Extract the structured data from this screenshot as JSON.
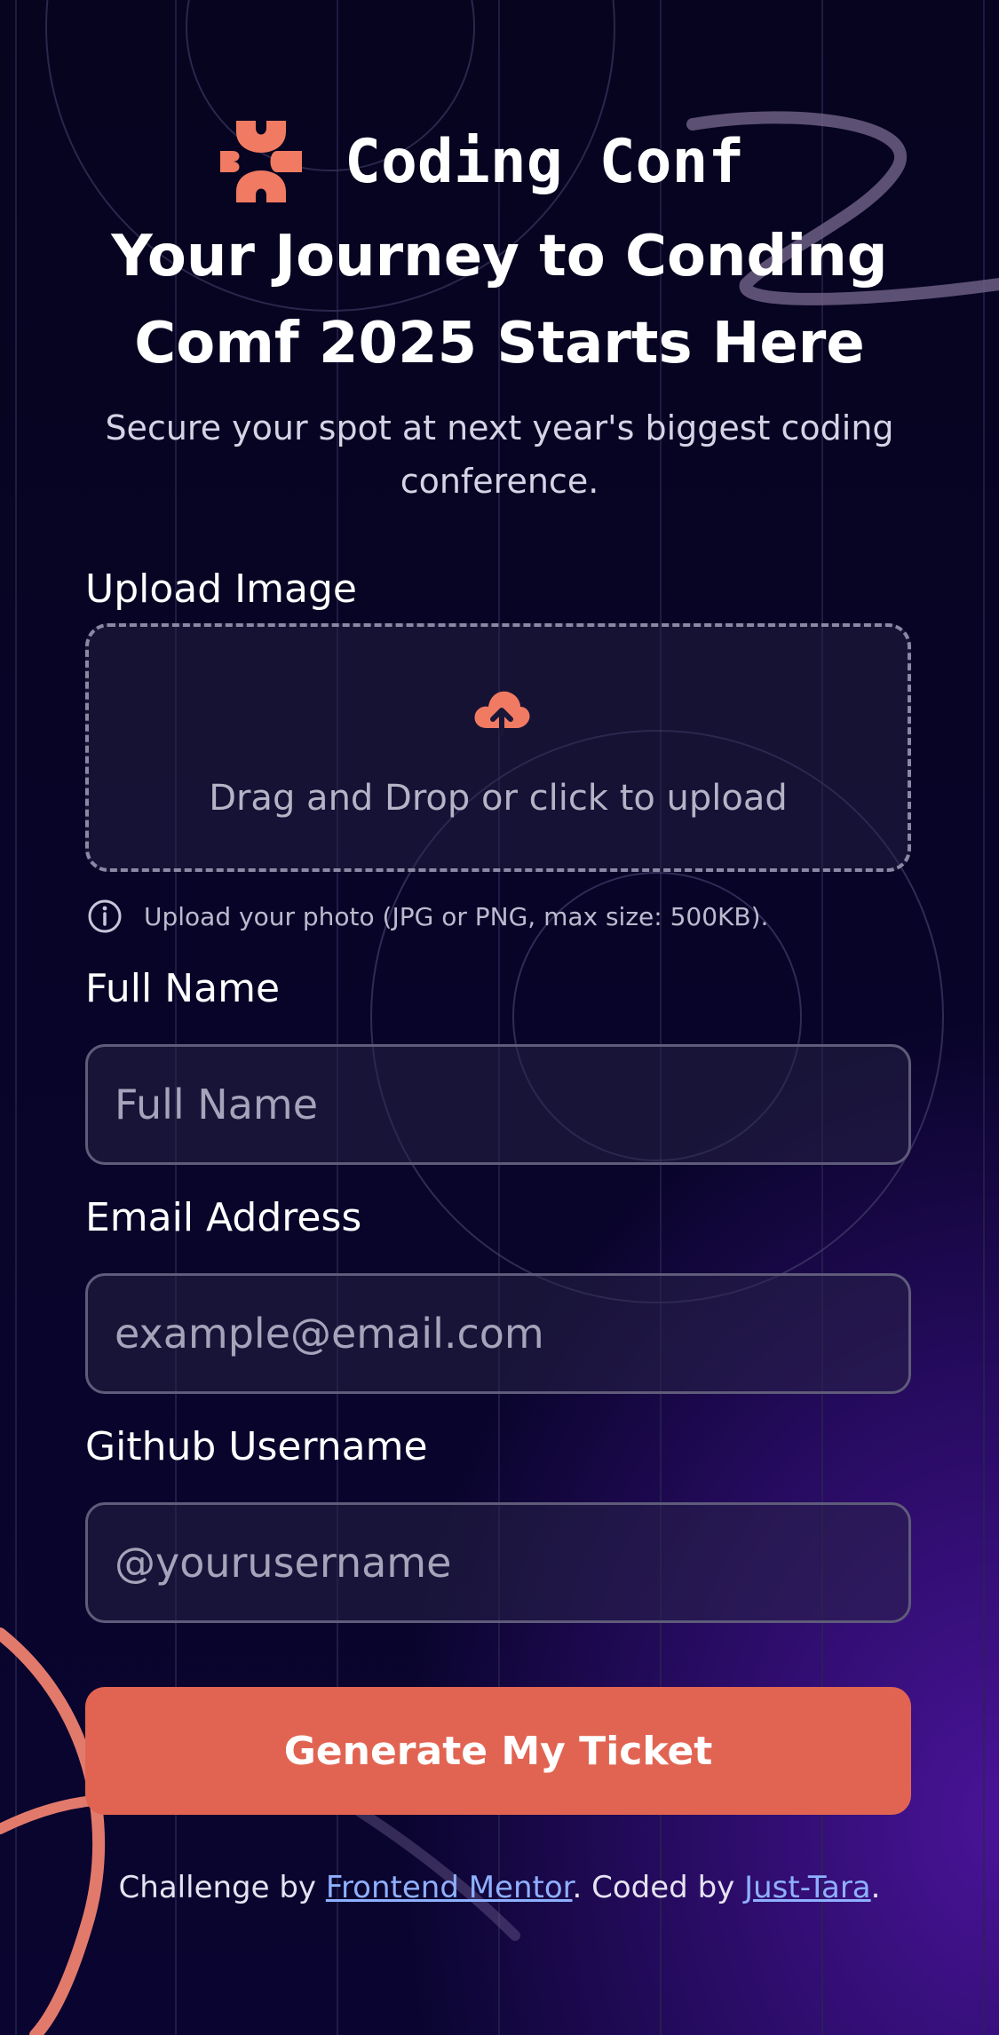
{
  "colors": {
    "accent": "#e16452",
    "background": "#07041f",
    "link": "#8fb0ff"
  },
  "brand": {
    "name": "Coding Conf",
    "logo_icon": "coding-conf-logo"
  },
  "hero": {
    "headline": "Your Journey to Conding Comf 2025 Starts Here",
    "subtitle": "Secure your spot at next year's biggest coding conference."
  },
  "form": {
    "upload": {
      "label": "Upload Image",
      "icon": "upload-cloud-icon",
      "prompt": "Drag and Drop or click to upload",
      "hint_icon": "info-icon",
      "hint": "Upload your photo (JPG or PNG, max size: 500KB)."
    },
    "full_name": {
      "label": "Full Name",
      "placeholder": "Full Name",
      "value": ""
    },
    "email": {
      "label": "Email Address",
      "placeholder": "example@email.com",
      "value": ""
    },
    "github": {
      "label": "Github Username",
      "placeholder": "@yourusername",
      "value": ""
    },
    "submit_label": "Generate My Ticket"
  },
  "footer": {
    "prefix": "Challenge by ",
    "challenge_link": "Frontend Mentor",
    "middle": ". Coded by ",
    "author_link": "Just-Tara",
    "suffix": "."
  }
}
